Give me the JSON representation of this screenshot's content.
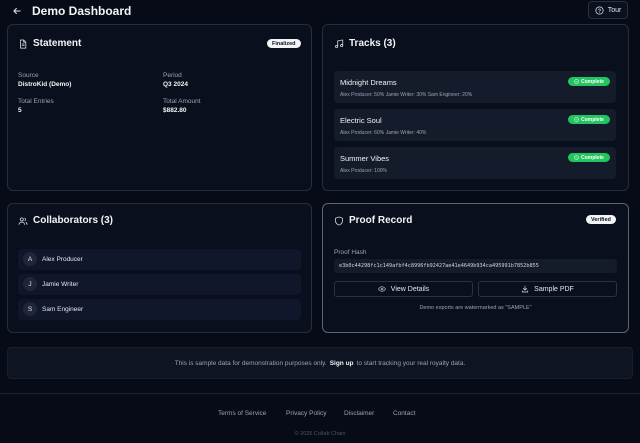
{
  "header": {
    "title": "Demo Dashboard",
    "tour_label": "Tour"
  },
  "statement": {
    "title": "Statement",
    "badge": "Finalized",
    "source_label": "Source",
    "source_value": "DistroKid (Demo)",
    "period_label": "Period",
    "period_value": "Q3 2024",
    "entries_label": "Total Entries",
    "entries_value": "5",
    "amount_label": "Total Amount",
    "amount_value": "$882.80"
  },
  "tracks": {
    "title": "Tracks (3)",
    "items": [
      {
        "name": "Midnight Dreams",
        "status": "Complete",
        "splits": "Alex Producer: 50%   Jamie Writer: 30%   Sam Engineer: 20%"
      },
      {
        "name": "Electric Soul",
        "status": "Complete",
        "splits": "Alex Producer: 60%   Jamie Writer: 40%"
      },
      {
        "name": "Summer Vibes",
        "status": "Complete",
        "splits": "Alex Producer: 100%"
      }
    ]
  },
  "collaborators": {
    "title": "Collaborators (3)",
    "items": [
      {
        "initial": "A",
        "name": "Alex Producer"
      },
      {
        "initial": "J",
        "name": "Jamie Writer"
      },
      {
        "initial": "S",
        "name": "Sam Engineer"
      }
    ]
  },
  "proof": {
    "title": "Proof Record",
    "badge": "Verified",
    "hash_label": "Proof Hash",
    "hash_value": "e3b0c44298fc1c149afbf4c8996fb92427ae41e4649b934ca495991b7852b855",
    "view_details_label": "View Details",
    "sample_pdf_label": "Sample PDF",
    "note": "Demo exports are watermarked as \"SAMPLE\""
  },
  "banner": {
    "prefix": "This is sample data for demonstration purposes only.",
    "signup": "Sign up",
    "suffix": "to start tracking your real royalty data."
  },
  "footer": {
    "links": [
      "Terms of Service",
      "Privacy Policy",
      "Disclaimer",
      "Contact"
    ],
    "copyright": "© 2026 Collab Chain"
  },
  "colors": {
    "background": "#070b17",
    "card": "#0a0f1d",
    "complete_green": "#22c55e"
  }
}
